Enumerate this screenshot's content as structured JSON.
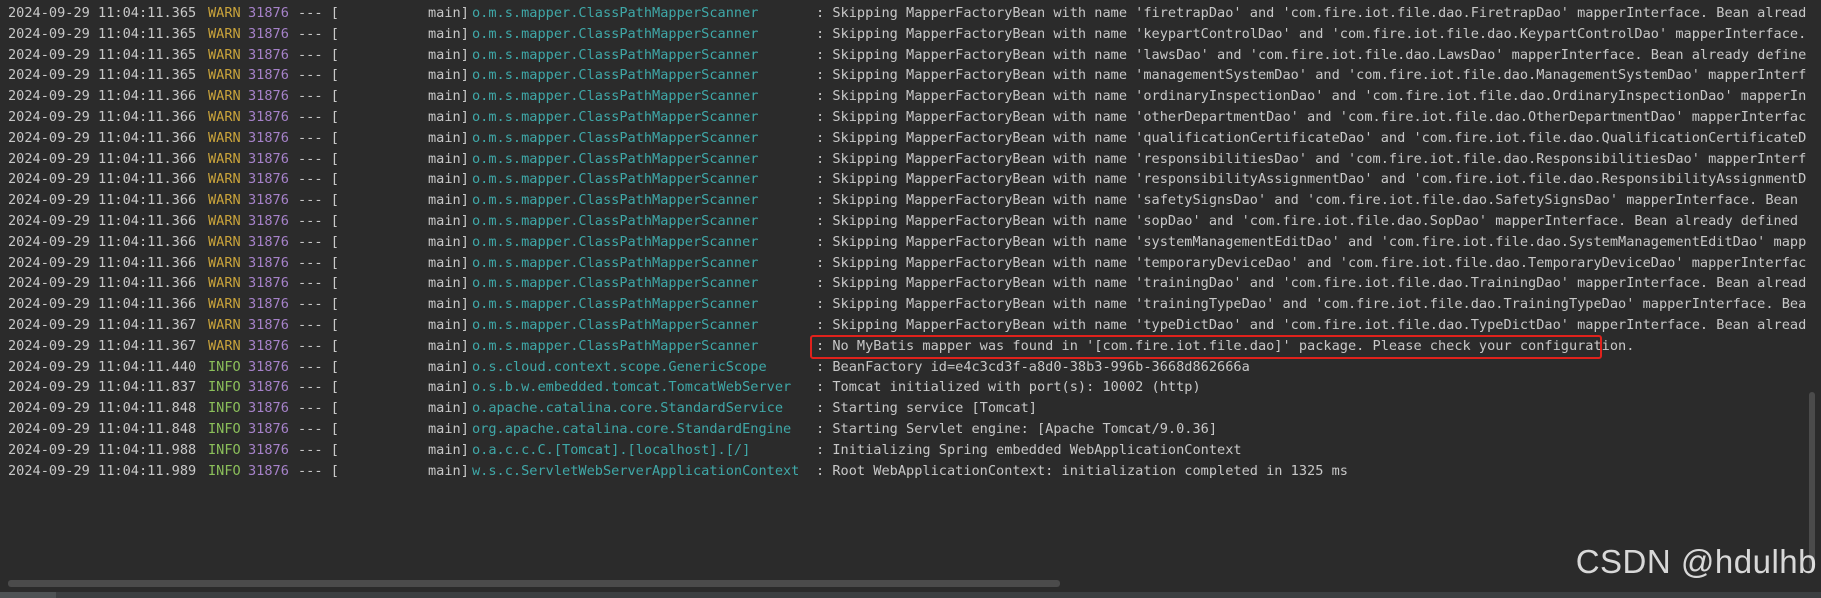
{
  "console": {
    "lines": [
      {
        "ts": "2024-09-29 11:04:11.365",
        "level": "WARN",
        "pid": "31876",
        "sep": "--- [",
        "thread": "main]",
        "logger": "o.m.s.mapper.ClassPathMapperScanner",
        "msg": ": Skipping MapperFactoryBean with name 'firetrapDao' and 'com.fire.iot.file.dao.FiretrapDao' mapperInterface. Bean already defi"
      },
      {
        "ts": "2024-09-29 11:04:11.365",
        "level": "WARN",
        "pid": "31876",
        "sep": "--- [",
        "thread": "main]",
        "logger": "o.m.s.mapper.ClassPathMapperScanner",
        "msg": ": Skipping MapperFactoryBean with name 'keypartControlDao' and 'com.fire.iot.file.dao.KeypartControlDao' mapperInterface. Bean "
      },
      {
        "ts": "2024-09-29 11:04:11.365",
        "level": "WARN",
        "pid": "31876",
        "sep": "--- [",
        "thread": "main]",
        "logger": "o.m.s.mapper.ClassPathMapperScanner",
        "msg": ": Skipping MapperFactoryBean with name 'lawsDao' and 'com.fire.iot.file.dao.LawsDao' mapperInterface. Bean already defined with"
      },
      {
        "ts": "2024-09-29 11:04:11.365",
        "level": "WARN",
        "pid": "31876",
        "sep": "--- [",
        "thread": "main]",
        "logger": "o.m.s.mapper.ClassPathMapperScanner",
        "msg": ": Skipping MapperFactoryBean with name 'managementSystemDao' and 'com.fire.iot.file.dao.ManagementSystemDao' mapperInterface. B"
      },
      {
        "ts": "2024-09-29 11:04:11.366",
        "level": "WARN",
        "pid": "31876",
        "sep": "--- [",
        "thread": "main]",
        "logger": "o.m.s.mapper.ClassPathMapperScanner",
        "msg": ": Skipping MapperFactoryBean with name 'ordinaryInspectionDao' and 'com.fire.iot.file.dao.OrdinaryInspectionDao' mapperInterfac"
      },
      {
        "ts": "2024-09-29 11:04:11.366",
        "level": "WARN",
        "pid": "31876",
        "sep": "--- [",
        "thread": "main]",
        "logger": "o.m.s.mapper.ClassPathMapperScanner",
        "msg": ": Skipping MapperFactoryBean with name 'otherDepartmentDao' and 'com.fire.iot.file.dao.OtherDepartmentDao' mapperInterface. Bea"
      },
      {
        "ts": "2024-09-29 11:04:11.366",
        "level": "WARN",
        "pid": "31876",
        "sep": "--- [",
        "thread": "main]",
        "logger": "o.m.s.mapper.ClassPathMapperScanner",
        "msg": ": Skipping MapperFactoryBean with name 'qualificationCertificateDao' and 'com.fire.iot.file.dao.QualificationCertificateDao' ma"
      },
      {
        "ts": "2024-09-29 11:04:11.366",
        "level": "WARN",
        "pid": "31876",
        "sep": "--- [",
        "thread": "main]",
        "logger": "o.m.s.mapper.ClassPathMapperScanner",
        "msg": ": Skipping MapperFactoryBean with name 'responsibilitiesDao' and 'com.fire.iot.file.dao.ResponsibilitiesDao' mapperInterface. B"
      },
      {
        "ts": "2024-09-29 11:04:11.366",
        "level": "WARN",
        "pid": "31876",
        "sep": "--- [",
        "thread": "main]",
        "logger": "o.m.s.mapper.ClassPathMapperScanner",
        "msg": ": Skipping MapperFactoryBean with name 'responsibilityAssignmentDao' and 'com.fire.iot.file.dao.ResponsibilityAssignmentDao' ma"
      },
      {
        "ts": "2024-09-29 11:04:11.366",
        "level": "WARN",
        "pid": "31876",
        "sep": "--- [",
        "thread": "main]",
        "logger": "o.m.s.mapper.ClassPathMapperScanner",
        "msg": ": Skipping MapperFactoryBean with name 'safetySignsDao' and 'com.fire.iot.file.dao.SafetySignsDao' mapperInterface. Bean alread"
      },
      {
        "ts": "2024-09-29 11:04:11.366",
        "level": "WARN",
        "pid": "31876",
        "sep": "--- [",
        "thread": "main]",
        "logger": "o.m.s.mapper.ClassPathMapperScanner",
        "msg": ": Skipping MapperFactoryBean with name 'sopDao' and 'com.fire.iot.file.dao.SopDao' mapperInterface. Bean already defined with t"
      },
      {
        "ts": "2024-09-29 11:04:11.366",
        "level": "WARN",
        "pid": "31876",
        "sep": "--- [",
        "thread": "main]",
        "logger": "o.m.s.mapper.ClassPathMapperScanner",
        "msg": ": Skipping MapperFactoryBean with name 'systemManagementEditDao' and 'com.fire.iot.file.dao.SystemManagementEditDao' mapperInte"
      },
      {
        "ts": "2024-09-29 11:04:11.366",
        "level": "WARN",
        "pid": "31876",
        "sep": "--- [",
        "thread": "main]",
        "logger": "o.m.s.mapper.ClassPathMapperScanner",
        "msg": ": Skipping MapperFactoryBean with name 'temporaryDeviceDao' and 'com.fire.iot.file.dao.TemporaryDeviceDao' mapperInterface. Bea"
      },
      {
        "ts": "2024-09-29 11:04:11.366",
        "level": "WARN",
        "pid": "31876",
        "sep": "--- [",
        "thread": "main]",
        "logger": "o.m.s.mapper.ClassPathMapperScanner",
        "msg": ": Skipping MapperFactoryBean with name 'trainingDao' and 'com.fire.iot.file.dao.TrainingDao' mapperInterface. Bean already defi"
      },
      {
        "ts": "2024-09-29 11:04:11.366",
        "level": "WARN",
        "pid": "31876",
        "sep": "--- [",
        "thread": "main]",
        "logger": "o.m.s.mapper.ClassPathMapperScanner",
        "msg": ": Skipping MapperFactoryBean with name 'trainingTypeDao' and 'com.fire.iot.file.dao.TrainingTypeDao' mapperInterface. Bean alre"
      },
      {
        "ts": "2024-09-29 11:04:11.367",
        "level": "WARN",
        "pid": "31876",
        "sep": "--- [",
        "thread": "main]",
        "logger": "o.m.s.mapper.ClassPathMapperScanner",
        "msg": ": Skipping MapperFactoryBean with name 'typeDictDao' and 'com.fire.iot.file.dao.TypeDictDao' mapperInterface. Bean already defi"
      },
      {
        "ts": "2024-09-29 11:04:11.367",
        "level": "WARN",
        "pid": "31876",
        "sep": "--- [",
        "thread": "main]",
        "logger": "o.m.s.mapper.ClassPathMapperScanner",
        "msg": ": No MyBatis mapper was found in '[com.fire.iot.file.dao]' package. Please check your configuration."
      },
      {
        "ts": "2024-09-29 11:04:11.440",
        "level": "INFO",
        "pid": "31876",
        "sep": "--- [",
        "thread": "main]",
        "logger": "o.s.cloud.context.scope.GenericScope",
        "msg": ": BeanFactory id=e4c3cd3f-a8d0-38b3-996b-3668d862666a"
      },
      {
        "ts": "2024-09-29 11:04:11.837",
        "level": "INFO",
        "pid": "31876",
        "sep": "--- [",
        "thread": "main]",
        "logger": "o.s.b.w.embedded.tomcat.TomcatWebServer",
        "msg": ": Tomcat initialized with port(s): 10002 (http)"
      },
      {
        "ts": "2024-09-29 11:04:11.848",
        "level": "INFO",
        "pid": "31876",
        "sep": "--- [",
        "thread": "main]",
        "logger": "o.apache.catalina.core.StandardService",
        "msg": ": Starting service [Tomcat]"
      },
      {
        "ts": "2024-09-29 11:04:11.848",
        "level": "INFO",
        "pid": "31876",
        "sep": "--- [",
        "thread": "main]",
        "logger": "org.apache.catalina.core.StandardEngine",
        "msg": ": Starting Servlet engine: [Apache Tomcat/9.0.36]"
      },
      {
        "ts": "2024-09-29 11:04:11.988",
        "level": "INFO",
        "pid": "31876",
        "sep": "--- [",
        "thread": "main]",
        "logger": "o.a.c.c.C.[Tomcat].[localhost].[/]",
        "msg": ": Initializing Spring embedded WebApplicationContext"
      },
      {
        "ts": "2024-09-29 11:04:11.989",
        "level": "INFO",
        "pid": "31876",
        "sep": "--- [",
        "thread": "main]",
        "logger": "w.s.c.ServletWebServerApplicationContext",
        "msg": ": Root WebApplicationContext: initialization completed in 1325 ms"
      }
    ]
  },
  "highlighted_line_index": 16,
  "watermark": "CSDN @hdulhb",
  "colors": {
    "background": "#2b2b2b",
    "warn": "#c9a33b",
    "info": "#8bbf5a",
    "pid": "#a682c9",
    "logger": "#3fa8a8",
    "highlight_border": "#e0221c"
  }
}
